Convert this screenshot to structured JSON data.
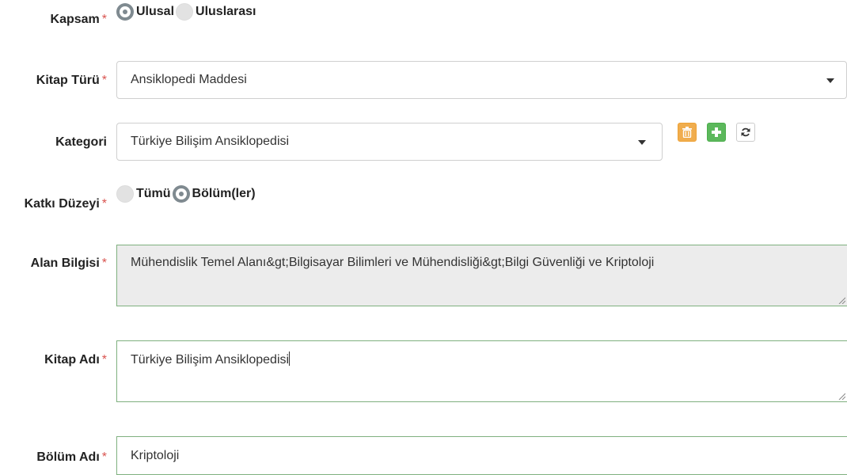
{
  "required_mark": "*",
  "kapsam": {
    "label": "Kapsam",
    "options": [
      {
        "label": "Ulusal",
        "selected": true
      },
      {
        "label": "Uluslarası",
        "selected": false
      }
    ]
  },
  "kitap_turu": {
    "label": "Kitap Türü",
    "value": "Ansiklopedi Maddesi"
  },
  "kategori": {
    "label": "Kategori",
    "value": "Türkiye Bilişim Ansiklopedisi",
    "buttons": {
      "delete_icon": "trash-icon",
      "add_icon": "plus-icon",
      "refresh_icon": "refresh-icon"
    }
  },
  "katki_duzeyi": {
    "label": "Katkı Düzeyi",
    "options": [
      {
        "label": "Tümü",
        "selected": false
      },
      {
        "label": "Bölüm(ler)",
        "selected": true
      }
    ]
  },
  "alan_bilgisi": {
    "label": "Alan Bilgisi",
    "value": "Mühendislik Temel Alanı&gt;Bilgisayar Bilimleri ve Mühendisliği&gt;Bilgi Güvenliği ve Kriptoloji"
  },
  "kitap_adi": {
    "label": "Kitap Adı",
    "value": "Türkiye Bilişim Ansiklopedisi"
  },
  "bolum_adi": {
    "label": "Bölüm Adı",
    "value": "Kriptoloji"
  },
  "colors": {
    "required": "#d9534f",
    "delete_button": "#f0ad4e",
    "add_button": "#5cb85c",
    "valid_border": "#7fb07f",
    "readonly_bg": "#ececec"
  }
}
